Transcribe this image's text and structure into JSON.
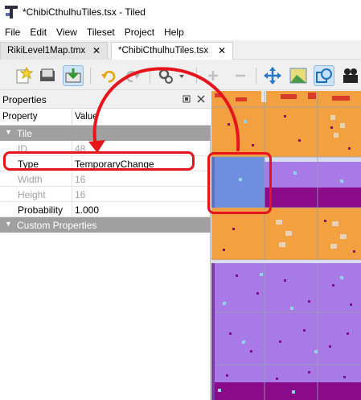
{
  "window": {
    "title": "*ChibiCthulhuTiles.tsx - Tiled"
  },
  "menu": [
    "File",
    "Edit",
    "View",
    "Tileset",
    "Project",
    "Help"
  ],
  "tabs": [
    {
      "label": "RikiLevel1Map.tmx",
      "close": "✕",
      "active": false
    },
    {
      "label": "*ChibiCthulhuTiles.tsx",
      "close": "✕",
      "active": true
    }
  ],
  "toolbar": {
    "icons": [
      "new-tileset-icon",
      "open-icon",
      "save-icon",
      "undo-icon",
      "redo-icon",
      "settings-icon",
      "add-icon",
      "remove-icon",
      "move-icon",
      "image-icon",
      "shape-icon",
      "film-icon"
    ]
  },
  "properties": {
    "title": "Properties",
    "col_property": "Property",
    "col_value": "Value",
    "group_tile": "Tile",
    "rows": [
      {
        "key": "ID",
        "value": "48",
        "disabled": true
      },
      {
        "key": "Type",
        "value": "TemporaryChange",
        "disabled": false
      },
      {
        "key": "Width",
        "value": "16",
        "disabled": true
      },
      {
        "key": "Height",
        "value": "16",
        "disabled": true
      },
      {
        "key": "Probability",
        "value": "1.000",
        "disabled": false
      }
    ],
    "group_custom": "Custom Properties"
  },
  "colors": {
    "highlight": "#e8141c",
    "orange_tile": "#f2a040",
    "purple_tile": "#a87ae8",
    "selected_tile": "#6f8ee0"
  }
}
